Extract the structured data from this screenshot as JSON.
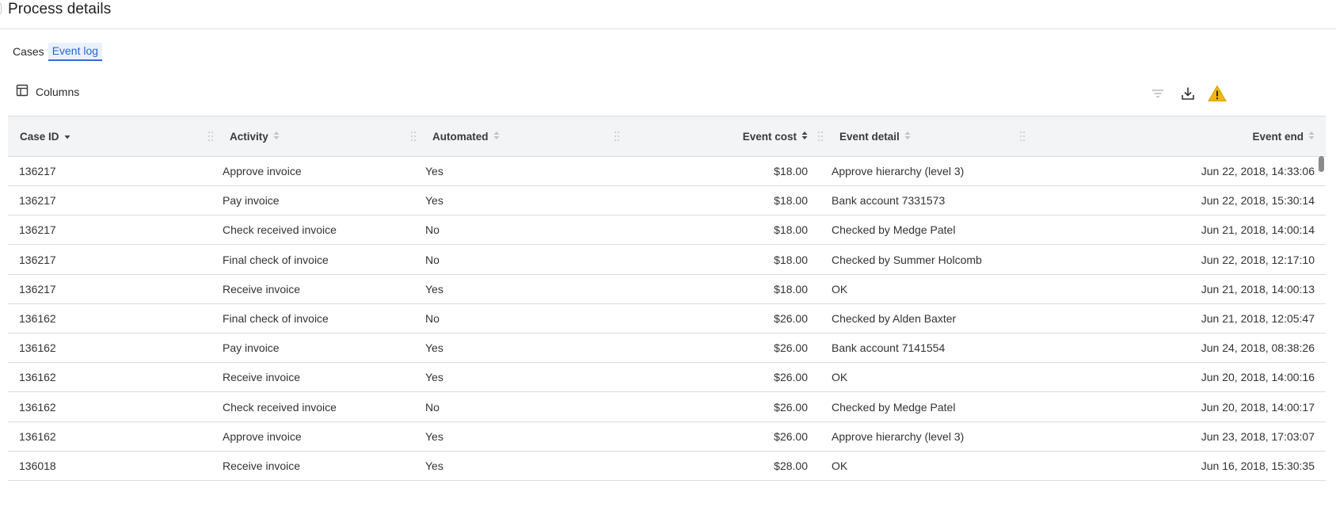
{
  "page": {
    "title": "Process details"
  },
  "tabs": [
    {
      "label": "Cases",
      "active": false
    },
    {
      "label": "Event log",
      "active": true
    }
  ],
  "toolbar": {
    "columns_label": "Columns",
    "icons": [
      "filter-icon",
      "download-icon",
      "warning-icon"
    ],
    "warning_color": "#f2b705"
  },
  "table": {
    "columns": [
      {
        "label": "Case ID",
        "sort": "descending"
      },
      {
        "label": "Activity",
        "sort": "none"
      },
      {
        "label": "Automated",
        "sort": "none"
      },
      {
        "label": "Event cost",
        "sort": "active"
      },
      {
        "label": "Event detail",
        "sort": "none"
      },
      {
        "label": "Event end",
        "sort": "none"
      }
    ],
    "rows": [
      [
        "136217",
        "Approve invoice",
        "Yes",
        "$18.00",
        "Approve hierarchy (level 3)",
        "Jun 22, 2018, 14:33:06"
      ],
      [
        "136217",
        "Pay invoice",
        "Yes",
        "$18.00",
        "Bank account 7331573",
        "Jun 22, 2018, 15:30:14"
      ],
      [
        "136217",
        "Check received invoice",
        "No",
        "$18.00",
        "Checked by Medge Patel",
        "Jun 21, 2018, 14:00:14"
      ],
      [
        "136217",
        "Final check of invoice",
        "No",
        "$18.00",
        "Checked by Summer Holcomb",
        "Jun 22, 2018, 12:17:10"
      ],
      [
        "136217",
        "Receive invoice",
        "Yes",
        "$18.00",
        "OK",
        "Jun 21, 2018, 14:00:13"
      ],
      [
        "136162",
        "Final check of invoice",
        "No",
        "$26.00",
        "Checked by Alden Baxter",
        "Jun 21, 2018, 12:05:47"
      ],
      [
        "136162",
        "Pay invoice",
        "Yes",
        "$26.00",
        "Bank account 7141554",
        "Jun 24, 2018, 08:38:26"
      ],
      [
        "136162",
        "Receive invoice",
        "Yes",
        "$26.00",
        "OK",
        "Jun 20, 2018, 14:00:16"
      ],
      [
        "136162",
        "Check received invoice",
        "No",
        "$26.00",
        "Checked by Medge Patel",
        "Jun 20, 2018, 14:00:17"
      ],
      [
        "136162",
        "Approve invoice",
        "Yes",
        "$26.00",
        "Approve hierarchy (level 3)",
        "Jun 23, 2018, 17:03:07"
      ],
      [
        "136018",
        "Receive invoice",
        "Yes",
        "$28.00",
        "OK",
        "Jun 16, 2018, 15:30:35"
      ]
    ]
  }
}
